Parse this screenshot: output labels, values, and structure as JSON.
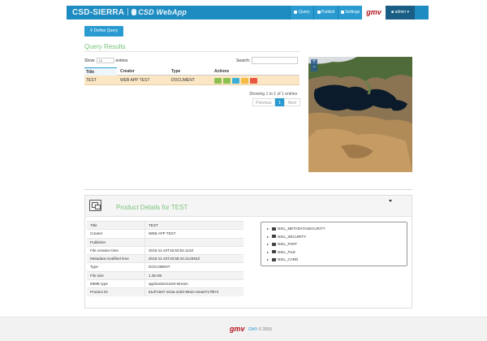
{
  "header": {
    "brand": "CSD-SIERRA",
    "app_name": "CSD WebApp",
    "nav": [
      {
        "label": "Query",
        "icon": "search-icon"
      },
      {
        "label": "Publish",
        "icon": "upload-icon"
      },
      {
        "label": "Settings",
        "icon": "gear-icon"
      }
    ],
    "logo": "gmv",
    "user": "admin"
  },
  "define_query_label": "Define Query",
  "query_results": {
    "title": "Query Results",
    "show_label": "Show",
    "entries_label": "entries",
    "page_size": "10",
    "search_label": "Search:",
    "search_value": "",
    "columns": [
      "Title",
      "Creator",
      "Type",
      "Actions"
    ],
    "rows": [
      {
        "title": "TEST",
        "creator": "WEB APP TEST",
        "type": "DOCUMENT"
      }
    ],
    "action_colors": [
      "#8cc152",
      "#8cc152",
      "#3bafda",
      "#f6bb42",
      "#e9573f"
    ],
    "info": "Showing 1 to 1 of 1 entries",
    "pager": {
      "previous": "Previous",
      "current": "1",
      "next": "Next"
    }
  },
  "map": {
    "zoom_in": "+",
    "zoom_out": "−"
  },
  "product": {
    "title": "Product Details for TEST",
    "properties": [
      {
        "key": "Title",
        "value": "TEST"
      },
      {
        "key": "Creator",
        "value": "WEB APP TEST"
      },
      {
        "key": "Publisher",
        "value": ""
      },
      {
        "key": "File creation time",
        "value": "2016-11-10T15:53:52.112Z"
      },
      {
        "key": "Metadata modified time",
        "value": "2016-11-10T15:58:44.214394Z"
      },
      {
        "key": "Type",
        "value": "DOCUMENT"
      },
      {
        "key": "File size",
        "value": "1.35 KB"
      },
      {
        "key": "MIME type",
        "value": "application/octet-stream"
      },
      {
        "key": "Product ID",
        "value": "61d71507-310a-41b0-9942-c0ea0717f874"
      }
    ],
    "tree": [
      "NSIL_METADATASECURITY",
      "NSIL_SECURITY",
      "NSIL_PART",
      "NSIL_FILE",
      "NSIL_CARD"
    ]
  },
  "footer": {
    "logo": "gmv",
    "brand": "GMV",
    "copyright": "© 2016"
  },
  "colors": {
    "header": "#1f8cc1",
    "accent_green": "#79c37a",
    "row_highlight": "#fce7c5"
  }
}
